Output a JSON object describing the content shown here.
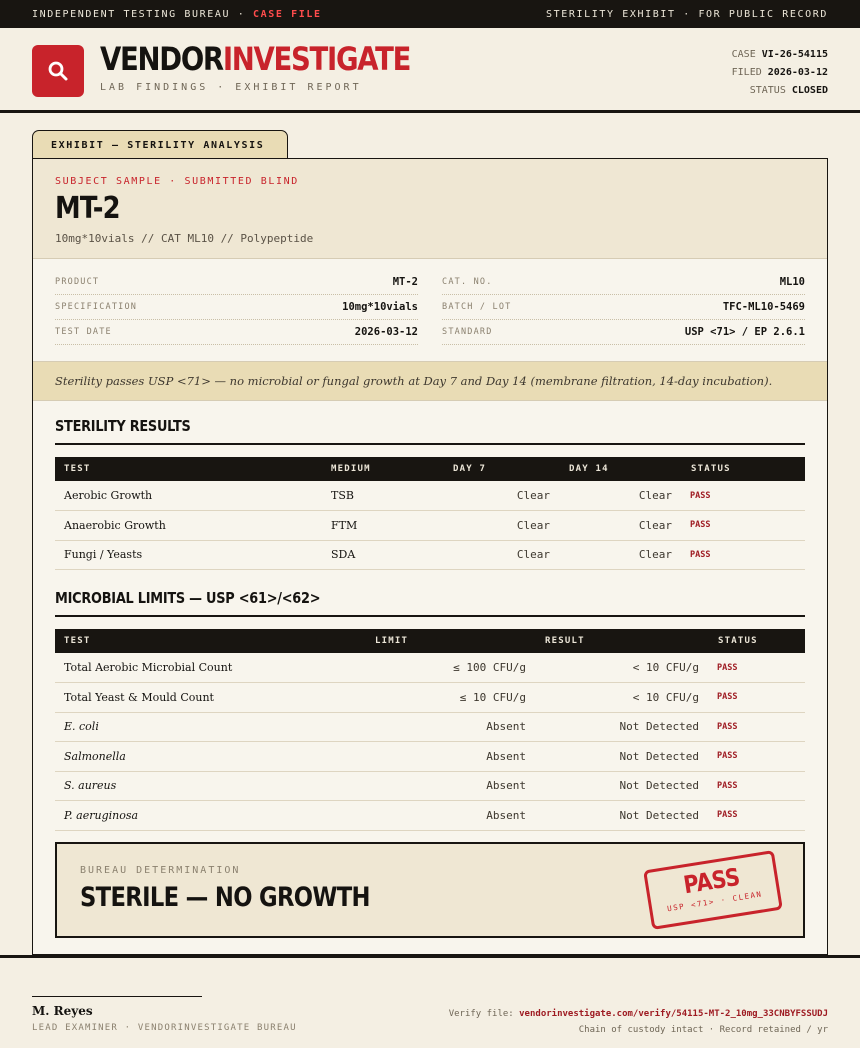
{
  "topbar": {
    "left_prefix": "INDEPENDENT TESTING BUREAU · ",
    "left_case": "CASE FILE",
    "right": "STERILITY EXHIBIT · FOR PUBLIC RECORD"
  },
  "header": {
    "brand_part1": "VENDOR",
    "brand_part2": "INVESTIGATE",
    "tagline": "LAB FINDINGS · EXHIBIT REPORT",
    "case_label": "CASE",
    "case_value": "VI-26-54115",
    "filed_label": "FILED",
    "filed_value": "2026-03-12",
    "status_label": "STATUS",
    "status_value": "CLOSED"
  },
  "exhibit": {
    "tab": "EXHIBIT — STERILITY ANALYSIS",
    "kicker": "SUBJECT SAMPLE · SUBMITTED BLIND",
    "title": "MT-2",
    "description": "10mg*10vials  //  CAT ML10  //  Polypeptide"
  },
  "fields": {
    "left": [
      {
        "label": "PRODUCT",
        "value": "MT-2"
      },
      {
        "label": "SPECIFICATION",
        "value": "10mg*10vials"
      },
      {
        "label": "TEST DATE",
        "value": "2026-03-12"
      }
    ],
    "right": [
      {
        "label": "CAT. NO.",
        "value": "ML10"
      },
      {
        "label": "BATCH / LOT",
        "value": "TFC-ML10-5469"
      },
      {
        "label": "STANDARD",
        "value": "USP <71> / EP 2.6.1"
      }
    ]
  },
  "note": "Sterility passes USP <71> — no microbial or fungal growth at Day 7 and Day 14 (membrane filtration, 14-day incubation).",
  "sterility": {
    "title": "STERILITY RESULTS",
    "headers": [
      "TEST",
      "MEDIUM",
      "DAY 7",
      "DAY 14",
      "STATUS"
    ],
    "rows": [
      {
        "test": "Aerobic Growth",
        "medium": "TSB",
        "day7": "Clear",
        "day14": "Clear",
        "status": "PASS"
      },
      {
        "test": "Anaerobic Growth",
        "medium": "FTM",
        "day7": "Clear",
        "day14": "Clear",
        "status": "PASS"
      },
      {
        "test": "Fungi / Yeasts",
        "medium": "SDA",
        "day7": "Clear",
        "day14": "Clear",
        "status": "PASS"
      }
    ]
  },
  "microbial": {
    "title": "MICROBIAL LIMITS — USP <61>/<62>",
    "headers": [
      "TEST",
      "LIMIT",
      "RESULT",
      "STATUS"
    ],
    "rows": [
      {
        "test": "Total Aerobic Microbial Count",
        "limit": "≤ 100 CFU/g",
        "result": "< 10 CFU/g",
        "status": "PASS"
      },
      {
        "test": "Total Yeast & Mould Count",
        "limit": "≤ 10 CFU/g",
        "result": "< 10 CFU/g",
        "status": "PASS"
      },
      {
        "test": "E. coli",
        "limit": "Absent",
        "result": "Not Detected",
        "status": "PASS"
      },
      {
        "test": "Salmonella",
        "limit": "Absent",
        "result": "Not Detected",
        "status": "PASS"
      },
      {
        "test": "S. aureus",
        "limit": "Absent",
        "result": "Not Detected",
        "status": "PASS"
      },
      {
        "test": "P. aeruginosa",
        "limit": "Absent",
        "result": "Not Detected",
        "status": "PASS"
      }
    ]
  },
  "determination": {
    "kicker": "BUREAU DETERMINATION",
    "verdict": "STERILE — NO GROWTH",
    "stamp_big": "PASS",
    "stamp_small": "USP <71> · CLEAN"
  },
  "footer": {
    "name": "M. Reyes",
    "role": "LEAD EXAMINER · VENDORINVESTIGATE BUREAU",
    "verify_label": "Verify file:",
    "verify_link": "vendorinvestigate.com/verify/54115-MT-2_10mg_33CNBYFSSUDJ",
    "custody": "Chain of custody intact · Record retained / yr"
  },
  "colors": {
    "accent_red": "#c8232b",
    "status_red": "#9e1b22",
    "ink": "#181511",
    "paper": "#f4efe3",
    "tan": "#e9dcb5"
  }
}
